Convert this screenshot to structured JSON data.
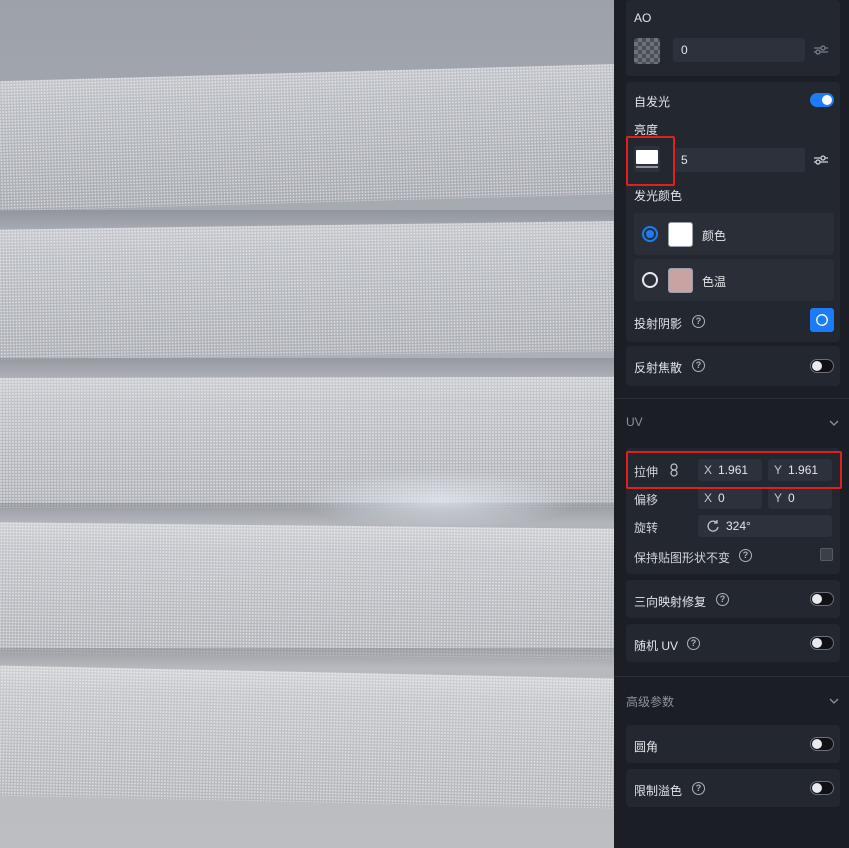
{
  "viewport": {
    "name": "3d-preview"
  },
  "material": {
    "ao": {
      "label": "AO",
      "value": "0"
    },
    "emission": {
      "label": "自发光",
      "enabled": true,
      "brightness_label": "亮度",
      "brightness_value": "5",
      "color_label": "发光颜色",
      "options": [
        {
          "label": "颜色",
          "selected": true,
          "swatch": "#ffffff"
        },
        {
          "label": "色温",
          "selected": false,
          "swatch": "#c9a3a1"
        }
      ],
      "cast_shadow_label": "投射阴影",
      "cast_shadow_enabled": true
    },
    "reflective_caustics": {
      "label": "反射焦散",
      "enabled": false
    }
  },
  "uv": {
    "title": "UV",
    "stretch": {
      "label": "拉伸",
      "x_axis": "X",
      "x": "1.961",
      "y_axis": "Y",
      "y": "1.961"
    },
    "offset": {
      "label": "偏移",
      "x_axis": "X",
      "x": "0",
      "y_axis": "Y",
      "y": "0"
    },
    "rotation": {
      "label": "旋转",
      "value": "324°"
    },
    "keep_shape": {
      "label": "保持贴图形状不变",
      "checked": false
    },
    "triplanar": {
      "label": "三向映射修复",
      "enabled": false
    },
    "random_uv": {
      "label": "随机 UV",
      "enabled": false
    }
  },
  "advanced": {
    "title": "高级参数",
    "rounded": {
      "label": "圆角",
      "enabled": false
    },
    "limit_overflow": {
      "label": "限制溢色",
      "enabled": false
    }
  },
  "help_glyph": "?",
  "colors": {
    "accent": "#1d7cf5",
    "highlight": "#e02020",
    "panel_bg": "#1b1e24",
    "card_bg": "#232730"
  }
}
